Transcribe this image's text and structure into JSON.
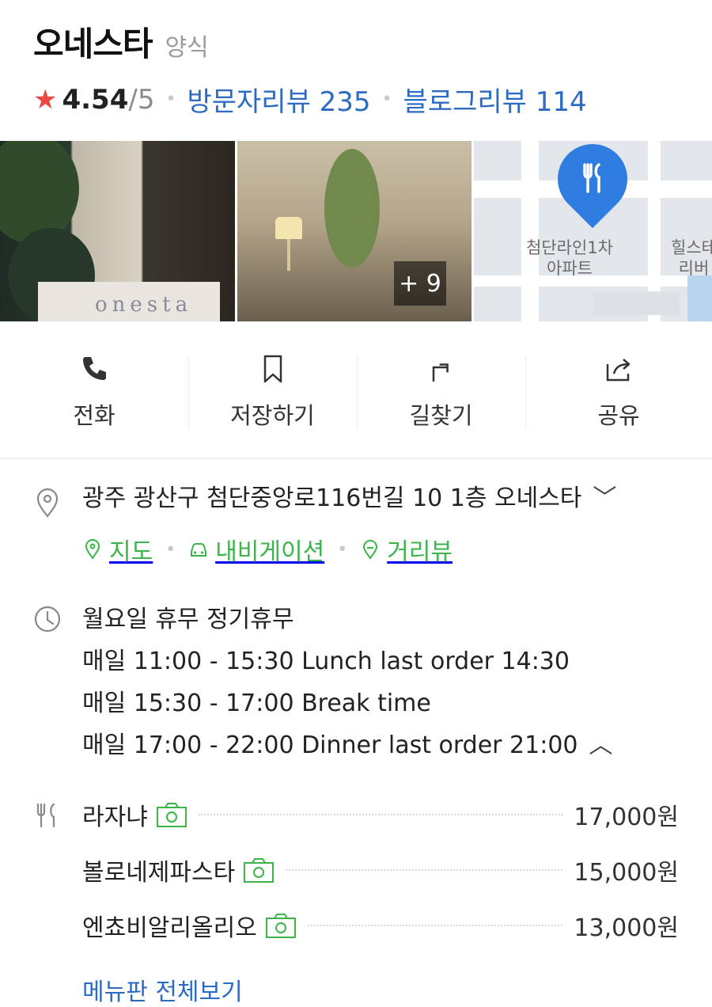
{
  "place": {
    "name": "오네스타",
    "category": "양식"
  },
  "rating": {
    "score": "4.54",
    "max": "/5",
    "visitor_reviews_label": "방문자리뷰 235",
    "blog_reviews_label": "블로그리뷰 114"
  },
  "photos": {
    "sign_text": "onesta",
    "more_count": "+ 9",
    "map_labels": {
      "apartment": "첨단라인1차\n아파트",
      "other": "힐스테\n리버"
    }
  },
  "actions": [
    {
      "label": "전화",
      "icon": "phone-icon"
    },
    {
      "label": "저장하기",
      "icon": "bookmark-icon"
    },
    {
      "label": "길찾기",
      "icon": "directions-icon"
    },
    {
      "label": "공유",
      "icon": "share-icon"
    }
  ],
  "address": {
    "text": "광주 광산구 첨단중앙로116번길 10 1층 오네스타",
    "links": [
      {
        "label": "지도",
        "icon": "map-pin-icon"
      },
      {
        "label": "내비게이션",
        "icon": "car-icon"
      },
      {
        "label": "거리뷰",
        "icon": "streetview-icon"
      }
    ]
  },
  "hours": {
    "closed": "월요일 휴무 정기휴무",
    "lines": [
      "매일 11:00 - 15:30 Lunch last order 14:30",
      "매일 15:30 - 17:00 Break time",
      "매일 17:00 - 22:00 Dinner last order 21:00"
    ]
  },
  "menu": {
    "items": [
      {
        "name": "라자냐",
        "price": "17,000원"
      },
      {
        "name": "볼로네제파스타",
        "price": "15,000원"
      },
      {
        "name": "엔쵸비알리올리오",
        "price": "13,000원"
      }
    ],
    "view_all": "메뉴판 전체보기"
  },
  "colors": {
    "star": "#e84a43",
    "link_blue": "#2c6bc4",
    "link_green": "#3bb54a",
    "map_pin": "#2f7de0"
  }
}
